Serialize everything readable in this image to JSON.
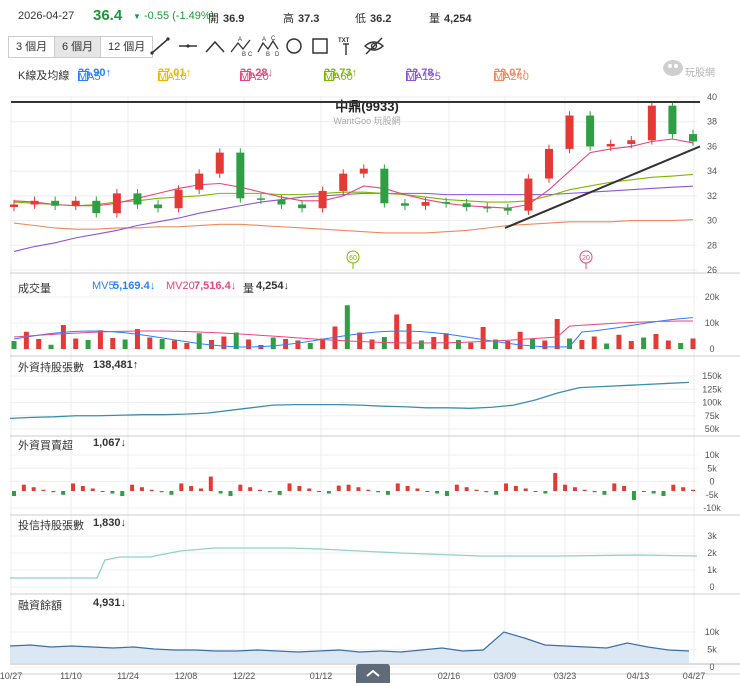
{
  "header": {
    "date": "2026-04-27",
    "price": "36.4",
    "change": "-0.55 (-1.49%)",
    "open_label": "開",
    "open": "36.9",
    "high_label": "高",
    "high": "37.3",
    "low_label": "低",
    "low": "36.2",
    "vol_label": "量",
    "vol": "4,254"
  },
  "ranges": [
    "3 個月",
    "6 個月",
    "12 個月"
  ],
  "active_range": 1,
  "tools": [
    "line-tool-icon",
    "horizontal-line-tool-icon",
    "wedge-tool-icon",
    "abc-pattern-tool-icon",
    "abcd-pattern-tool-icon",
    "circle-tool-icon",
    "rectangle-tool-icon",
    "text-tool-icon",
    "hide-drawings-icon"
  ],
  "tool_text": {
    "a": "A",
    "b": "B",
    "c": "C",
    "d": "D",
    "txt": "TXT"
  },
  "ma_legend": {
    "title": "K線及均線",
    "items": [
      {
        "label": "MA5",
        "value": "36.90↑",
        "color": "#2a7fff"
      },
      {
        "label": "MA10",
        "value": "37.01↑",
        "color": "#f0b400"
      },
      {
        "label": "MA20",
        "value": "36.28↓",
        "color": "#e8467c"
      },
      {
        "label": "MA60",
        "value": "33.73↑",
        "color": "#7ab800"
      },
      {
        "label": "MA125",
        "value": "32.78↓",
        "color": "#8b55d6"
      },
      {
        "label": "MA240",
        "value": "30.07↑",
        "color": "#f0875a"
      }
    ]
  },
  "watermark": {
    "title": "中鼎(9933)",
    "sub": "WantGoo 玩股網"
  },
  "logo_text": "玩股網",
  "volume_panel": {
    "title": "成交量",
    "mv5_label": "MV5",
    "mv5": "5,169.4↓",
    "mv20_label": "MV20",
    "mv20": "7,516.4↓",
    "vol_label": "量",
    "vol": "4,254↓",
    "yticks": [
      "20k",
      "10k",
      "0"
    ]
  },
  "foreign_hold": {
    "title": "外資持股張數",
    "value": "138,481↑",
    "yticks": [
      "150k",
      "125k",
      "100k",
      "75k",
      "50k"
    ]
  },
  "foreign_net": {
    "title": "外資買賣超",
    "value": "1,067↓",
    "yticks": [
      "10k",
      "5k",
      "0",
      "-5k",
      "-10k"
    ]
  },
  "trust_hold": {
    "title": "投信持股張數",
    "value": "1,830↓",
    "yticks": [
      "3k",
      "2k",
      "1k",
      "0"
    ]
  },
  "margin": {
    "title": "融資餘額",
    "value": "4,931↓",
    "yticks": [
      "10k",
      "5k",
      "0"
    ]
  },
  "xaxis": {
    "ticks": [
      "10/27",
      "11/10",
      "11/24",
      "12/08",
      "12/22",
      "01/12",
      "02/16",
      "03/09",
      "03/23",
      "04/13",
      "04/27"
    ]
  },
  "badges": [
    "60",
    "20"
  ],
  "chart_data": {
    "type": "candlestick",
    "title": "中鼎(9933)",
    "ylim": [
      26,
      40
    ],
    "yticks": [
      26,
      28,
      30,
      32,
      34,
      36,
      38,
      40
    ],
    "x": [
      "10/27",
      "11/10",
      "11/24",
      "12/08",
      "12/22",
      "01/12",
      "02/16",
      "03/09",
      "03/23",
      "04/13",
      "04/27"
    ],
    "close": [
      31.3,
      31.6,
      31.2,
      31.6,
      30.6,
      32.2,
      31.3,
      31.0,
      32.5,
      33.8,
      35.5,
      31.8,
      31.7,
      31.3,
      31.0,
      32.4,
      33.8,
      34.2,
      31.4,
      31.2,
      31.5,
      31.4,
      31.1,
      31.0,
      30.8,
      33.4,
      35.8,
      38.5,
      36.0,
      36.2,
      36.5,
      39.3,
      37.0,
      36.4
    ],
    "series": [
      {
        "name": "MA240",
        "values": [
          29.8,
          29.6,
          29.4,
          29.3,
          29.3,
          29.4,
          29.4,
          29.5,
          29.5,
          29.6,
          29.7,
          29.7,
          29.6,
          29.5,
          29.4,
          29.3,
          29.2,
          29.1,
          29.0,
          29.0,
          29.0,
          29.1,
          29.2,
          29.4,
          29.6,
          29.7,
          29.8,
          29.9,
          29.9,
          29.9,
          30.0,
          30.0,
          30.0,
          30.07
        ]
      },
      {
        "name": "MA125",
        "values": [
          27.5,
          27.9,
          28.2,
          28.6,
          28.9,
          29.2,
          29.6,
          29.9,
          30.2,
          30.6,
          30.9,
          31.2,
          31.5,
          31.7,
          31.9,
          32.0,
          32.1,
          32.2,
          32.2,
          32.2,
          32.2,
          32.1,
          32.1,
          32.1,
          32.1,
          32.1,
          32.1,
          32.2,
          32.3,
          32.4,
          32.5,
          32.6,
          32.7,
          32.78
        ]
      },
      {
        "name": "MA60",
        "values": [
          31.5,
          31.4,
          31.3,
          31.2,
          31.3,
          31.5,
          31.6,
          31.8,
          31.9,
          32.0,
          32.2,
          32.2,
          32.2,
          32.1,
          32.1,
          32.2,
          32.3,
          32.3,
          32.2,
          32.1,
          31.9,
          31.7,
          31.6,
          31.5,
          31.5,
          31.6,
          32.0,
          32.5,
          32.8,
          33.1,
          33.3,
          33.5,
          33.6,
          33.73
        ]
      },
      {
        "name": "MA20",
        "values": [
          31.6,
          31.5,
          31.3,
          31.2,
          31.2,
          31.4,
          31.8,
          32.2,
          32.6,
          32.9,
          33.0,
          32.7,
          32.3,
          31.9,
          31.6,
          31.6,
          32.0,
          32.8,
          32.6,
          32.1,
          31.7,
          31.4,
          31.2,
          31.1,
          31.0,
          31.3,
          32.5,
          34.0,
          35.5,
          35.8,
          36.0,
          36.4,
          36.6,
          36.28
        ]
      }
    ],
    "trendlines": [
      {
        "from": [
          "03/09",
          29.4
        ],
        "to": [
          "04/27",
          36.0
        ]
      },
      {
        "from": [
          "10/27",
          39.6
        ],
        "to": [
          "04/27",
          39.6
        ]
      }
    ]
  }
}
